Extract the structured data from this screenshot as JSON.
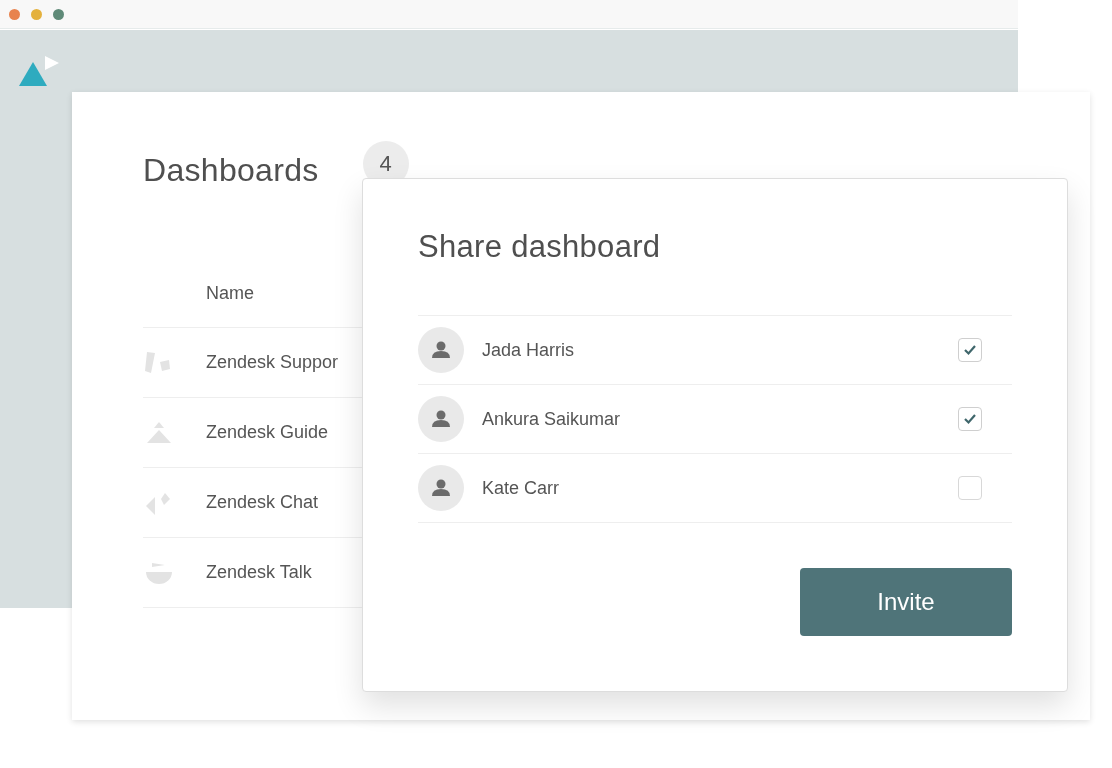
{
  "page": {
    "title": "Dashboards",
    "count": "4"
  },
  "table": {
    "columns": [
      "Name"
    ],
    "rows": [
      {
        "kind": "support",
        "name": "Zendesk Suppor"
      },
      {
        "kind": "guide",
        "name": "Zendesk Guide"
      },
      {
        "kind": "chat",
        "name": "Zendesk Chat"
      },
      {
        "kind": "talk",
        "name": "Zendesk Talk"
      }
    ]
  },
  "dialog": {
    "title": "Share dashboard",
    "people": [
      {
        "name": "Jada Harris",
        "checked": true
      },
      {
        "name": "Ankura Saikumar",
        "checked": true
      },
      {
        "name": "Kate Carr",
        "checked": false
      }
    ],
    "button": "Invite"
  }
}
